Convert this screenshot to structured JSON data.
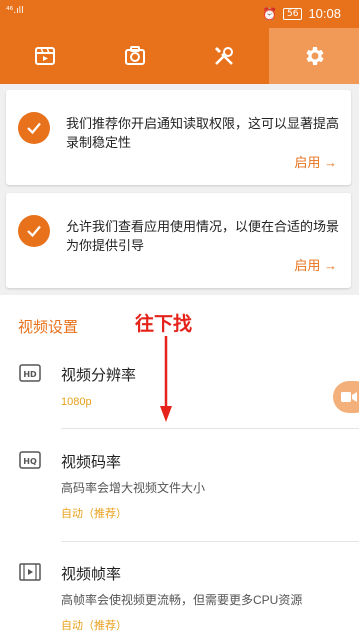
{
  "status_bar": {
    "signal": "⁴⁶.ıll",
    "battery": "56",
    "time": "10:08"
  },
  "tabs": [
    {
      "name": "video",
      "icon": "film-icon"
    },
    {
      "name": "camera",
      "icon": "camera-icon"
    },
    {
      "name": "tools",
      "icon": "tools-icon"
    },
    {
      "name": "settings",
      "icon": "gear-icon",
      "active": true
    }
  ],
  "cards": [
    {
      "text": "我们推荐你开启通知读取权限，这可以显著提高录制稳定性",
      "action": "启用 →"
    },
    {
      "text": "允许我们查看应用使用情况，以便在合适的场景为你提供引导",
      "action": "启用 →"
    }
  ],
  "annotation": "往下找",
  "video_settings": {
    "title": "视频设置",
    "items": [
      {
        "icon_label": "HD",
        "title": "视频分辨率",
        "desc": "",
        "value": "1080p"
      },
      {
        "icon_label": "HQ",
        "title": "视频码率",
        "desc": "高码率会增大视频文件大小",
        "value": "自动（推荐）"
      },
      {
        "icon_label": "",
        "title": "视频帧率",
        "desc": "高帧率会使视频更流畅，但需要更多CPU资源",
        "value": "自动（推荐）"
      }
    ]
  },
  "colors": {
    "accent": "#e8721c",
    "active_tab": "#f19a57",
    "value_text": "#e8a11c",
    "annotation": "#e5231b"
  }
}
